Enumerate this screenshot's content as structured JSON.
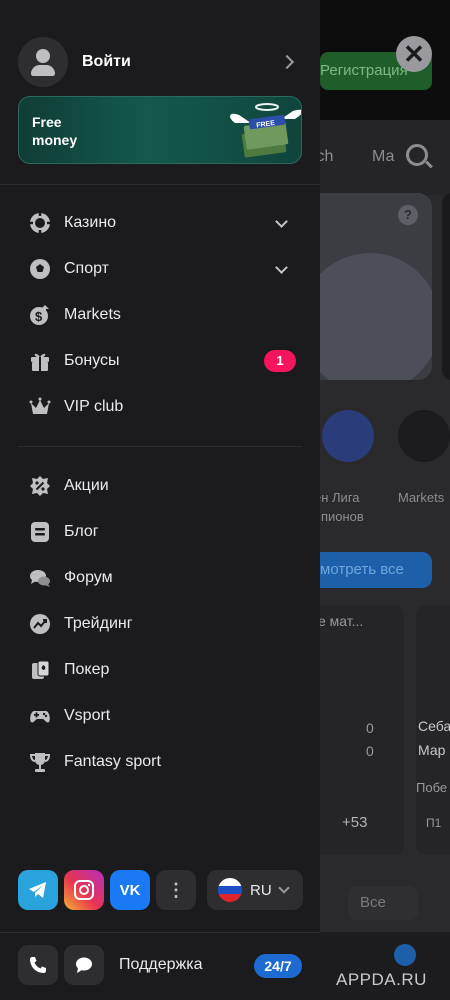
{
  "background": {
    "register_button": "Регистрация",
    "tabs": [
      "tch",
      "Ма"
    ],
    "avatar_labels": [
      "ен Лига",
      "мпионов",
      "Markets"
    ],
    "see_all_button": "мотреть все",
    "match_title": "е мат...",
    "match_title_2": "Себа",
    "match_title_3": "Мар",
    "score_a": "0",
    "score_b": "0",
    "odds_more": "+53",
    "result_label": "Побе",
    "p1_label": "П1",
    "all_button": "Все"
  },
  "watermark": "APPDA.RU",
  "login": {
    "label": "Войти"
  },
  "banner": {
    "text": "Free money",
    "money_label": "FREE"
  },
  "menu_primary": [
    {
      "label": "Казино",
      "icon": "casino-chip-icon",
      "expandable": true
    },
    {
      "label": "Спорт",
      "icon": "soccer-ball-icon",
      "expandable": true
    },
    {
      "label": "Markets",
      "icon": "markets-dollar-icon",
      "expandable": false
    },
    {
      "label": "Бонусы",
      "icon": "gift-icon",
      "badge": "1"
    },
    {
      "label": "VIP club",
      "icon": "crown-icon",
      "expandable": false
    }
  ],
  "menu_secondary": [
    {
      "label": "Акции",
      "icon": "percent-badge-icon"
    },
    {
      "label": "Блог",
      "icon": "blog-icon"
    },
    {
      "label": "Форум",
      "icon": "forum-icon"
    },
    {
      "label": "Трейдинг",
      "icon": "trading-icon"
    },
    {
      "label": "Покер",
      "icon": "poker-cards-icon"
    },
    {
      "label": "Vsport",
      "icon": "gamepad-icon"
    },
    {
      "label": "Fantasy sport",
      "icon": "trophy-icon"
    }
  ],
  "social": {
    "vk_label": "VK",
    "more_label": "⋮"
  },
  "language": {
    "code": "RU"
  },
  "support": {
    "label": "Поддержка",
    "badge": "24/7"
  },
  "colors": {
    "accent_pink": "#f5155d",
    "accent_blue": "#1d6bd1",
    "drawer_bg": "#1b1b1d"
  }
}
